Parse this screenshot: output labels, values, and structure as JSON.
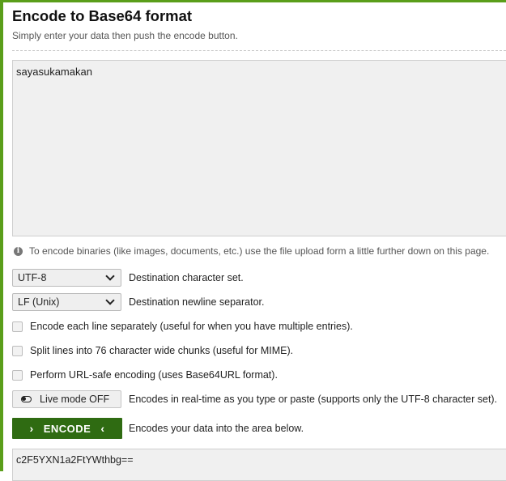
{
  "page": {
    "title": "Encode to Base64 format",
    "subtitle": "Simply enter your data then push the encode button."
  },
  "input": {
    "value": "sayasukamakan"
  },
  "info": {
    "text": "To encode binaries (like images, documents, etc.) use the file upload form a little further down on this page."
  },
  "charset": {
    "selected": "UTF-8",
    "label": "Destination character set."
  },
  "newline": {
    "selected": "LF (Unix)",
    "label": "Destination newline separator."
  },
  "options": [
    {
      "label": "Encode each line separately (useful for when you have multiple entries).",
      "checked": false
    },
    {
      "label": "Split lines into 76 character wide chunks (useful for MIME).",
      "checked": false
    },
    {
      "label": "Perform URL-safe encoding (uses Base64URL format).",
      "checked": false
    }
  ],
  "live_mode": {
    "button_label": "Live mode OFF",
    "description": "Encodes in real-time as you type or paste (supports only the UTF-8 character set)."
  },
  "encode": {
    "button_label": "ENCODE",
    "description": "Encodes your data into the area below."
  },
  "output": {
    "value": "c2F5YXN1a2FtYWthbg=="
  },
  "colors": {
    "accent": "#5a9e1a",
    "encode_button": "#2f6b12"
  }
}
